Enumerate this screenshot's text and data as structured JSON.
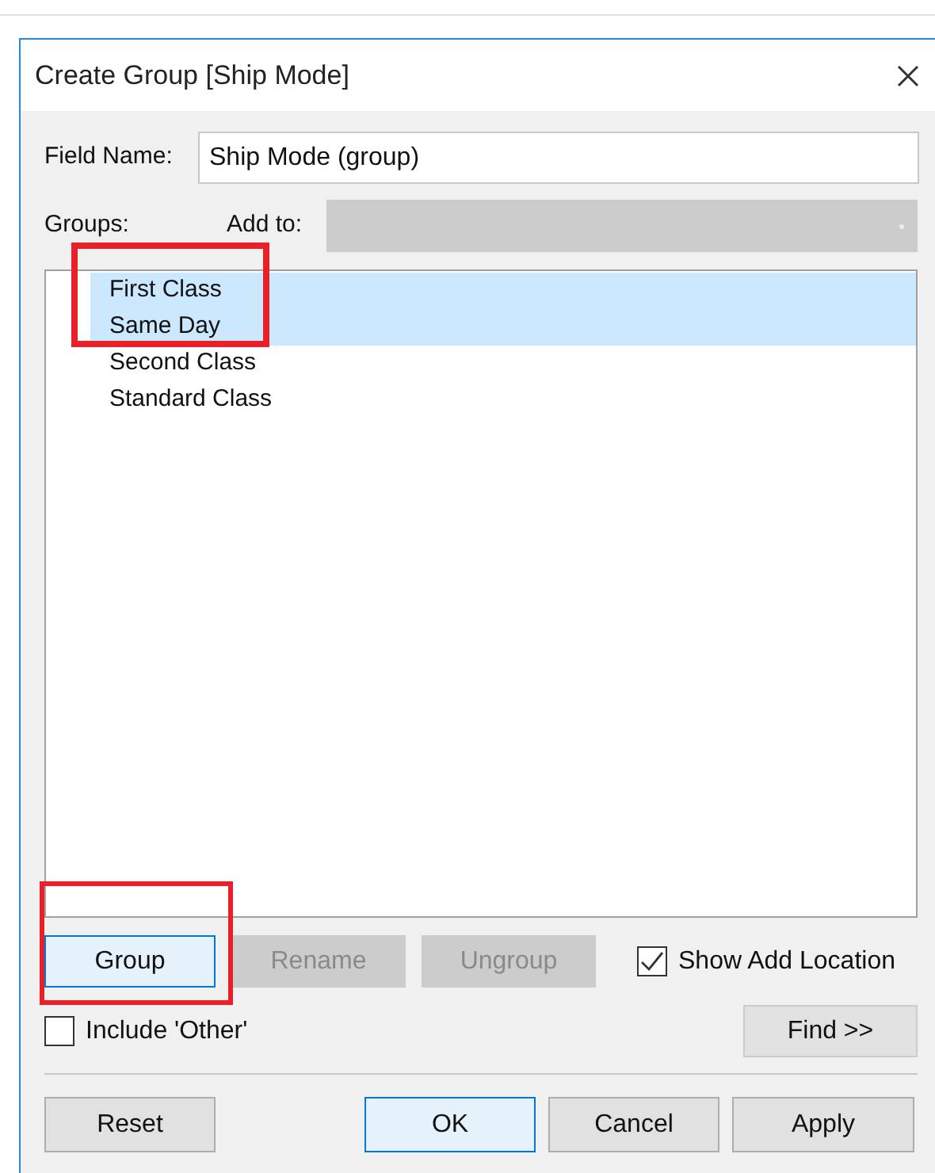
{
  "window": {
    "title": "Create Group [Ship Mode]"
  },
  "field_name": {
    "label": "Field Name:",
    "value": "Ship Mode (group)"
  },
  "groups_label": "Groups:",
  "add_to": {
    "label": "Add to:",
    "disabled": true
  },
  "groups": [
    {
      "label": "First Class",
      "selected": true
    },
    {
      "label": "Same Day",
      "selected": true
    },
    {
      "label": "Second Class",
      "selected": false
    },
    {
      "label": "Standard Class",
      "selected": false
    }
  ],
  "group_buttons": [
    {
      "label": "Group",
      "disabled": false,
      "focused": true
    },
    {
      "label": "Rename",
      "disabled": true,
      "focused": false
    },
    {
      "label": "Ungroup",
      "disabled": true,
      "focused": false
    }
  ],
  "show_add_location": {
    "label": "Show Add Location",
    "checked": true
  },
  "include_other": {
    "label": "Include 'Other'",
    "checked": false
  },
  "find_button": "Find >>",
  "footer_buttons": [
    {
      "label": "Reset",
      "focused": false
    },
    {
      "label": "OK",
      "focused": true
    },
    {
      "label": "Cancel",
      "focused": false
    },
    {
      "label": "Apply",
      "focused": false
    }
  ]
}
